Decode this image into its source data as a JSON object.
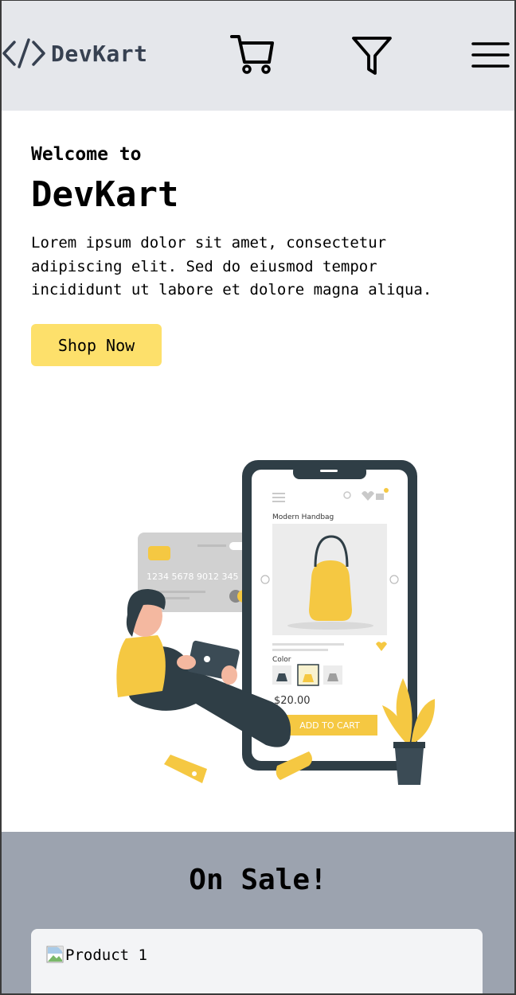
{
  "header": {
    "brand": "DevKart",
    "icons": [
      "code-icon",
      "cart-icon",
      "filter-icon",
      "menu-icon"
    ]
  },
  "hero": {
    "welcome": "Welcome to",
    "title": "DevKart",
    "description": "Lorem ipsum dolor sit amet, consectetur adipiscing elit. Sed do eiusmod tempor incididunt ut labore et dolore magna aliqua.",
    "cta_label": "Shop Now",
    "illustration": {
      "card_number": "1234 5678 9012 345",
      "product_name": "Modern Handbag",
      "color_label": "Color",
      "price": "$20.00",
      "add_to_cart": "ADD TO CART"
    }
  },
  "sale": {
    "title": "On Sale!",
    "products": [
      {
        "alt": "Product 1"
      }
    ]
  },
  "colors": {
    "nav_bg": "#e5e7eb",
    "accent": "#fde06b",
    "sale_bg": "#9ca3af",
    "card_bg": "#f3f4f6",
    "brand_text": "#374151"
  }
}
